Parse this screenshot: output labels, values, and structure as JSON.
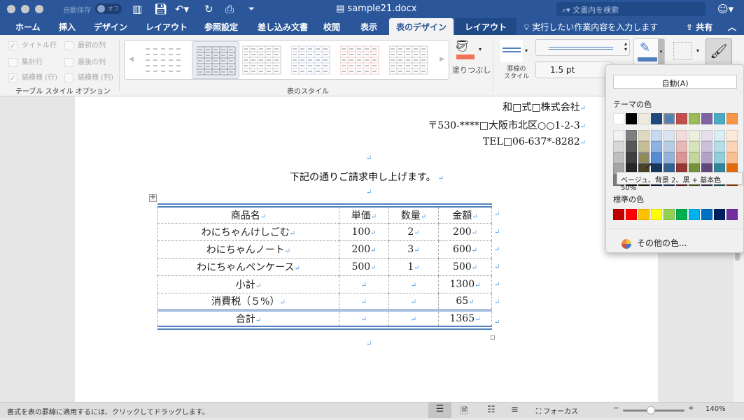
{
  "title": {
    "autosave": "自動保存",
    "autosave_state": "オフ",
    "doc": "sample21.docx",
    "search_placeholder": "文書内を検索"
  },
  "tabs": [
    "ホーム",
    "挿入",
    "デザイン",
    "レイアウト",
    "参照設定",
    "差し込み文書",
    "校閲",
    "表示",
    "表のデザイン",
    "レイアウト"
  ],
  "tell_me": "実行したい作業内容を入力します",
  "share": "共有",
  "ribbon": {
    "options": [
      {
        "label": "タイトル行",
        "checked": true
      },
      {
        "label": "最初の列",
        "checked": false
      },
      {
        "label": "集計行",
        "checked": false
      },
      {
        "label": "最後の列",
        "checked": false
      },
      {
        "label": "縞模様 (行)",
        "checked": true
      },
      {
        "label": "縞模様 (列)",
        "checked": false
      }
    ],
    "options_group": "テーブル スタイル オプション",
    "styles_group": "表のスタイル",
    "shading": "塗りつぶし",
    "border_style_l1": "罫線の",
    "border_style_l2": "スタイル",
    "pen_weight": "1.5 pt"
  },
  "document": {
    "company": "和□式□株式会社",
    "address": "〒530-****□大阪市北区○○1-2-3",
    "tel": "TEL□06-637*-8282",
    "intro": "下記の通りご請求申し上げます。",
    "table": [
      [
        "商品名",
        "単価",
        "数量",
        "金額"
      ],
      [
        "わにちゃんけしごむ",
        "100",
        "2",
        "200"
      ],
      [
        "わにちゃんノート",
        "200",
        "3",
        "600"
      ],
      [
        "わにちゃんペンケース",
        "500",
        "1",
        "500"
      ],
      [
        "小計",
        "",
        "",
        "1300"
      ],
      [
        "消費税（５%）",
        "",
        "",
        "65"
      ],
      [
        "合計",
        "",
        "",
        "1365"
      ]
    ]
  },
  "color_menu": {
    "auto": "自動(A)",
    "theme_label": "テーマの色",
    "standard_label": "標準の色",
    "tooltip": "ベージュ、背景 2、黒 + 基本色 50%",
    "more": "その他の色...",
    "theme_top": [
      "#ffffff",
      "#000000",
      "#eeece1",
      "#1f497d",
      "#4f81bd",
      "#c0504d",
      "#9bbb59",
      "#8064a2",
      "#4bacc6",
      "#f79646"
    ],
    "theme_shades": [
      [
        "#f2f2f2",
        "#d9d9d9",
        "#bfbfbf",
        "#a6a6a6",
        "#7f7f7f"
      ],
      [
        "#7f7f7f",
        "#595959",
        "#3f3f3f",
        "#262626",
        "#0d0d0d"
      ],
      [
        "#ddd9c3",
        "#c4bd97",
        "#938953",
        "#494429",
        "#1d1b10"
      ],
      [
        "#c6d9f0",
        "#8db3e2",
        "#548dd4",
        "#17365d",
        "#0f243e"
      ],
      [
        "#dbe5f1",
        "#b8cce4",
        "#95b3d7",
        "#366092",
        "#244061"
      ],
      [
        "#f2dcdb",
        "#e5b9b7",
        "#d99694",
        "#953734",
        "#632423"
      ],
      [
        "#ebf1dd",
        "#d7e3bc",
        "#c3d69b",
        "#76923c",
        "#4f6128"
      ],
      [
        "#e5e0ec",
        "#ccc1d9",
        "#b2a2c7",
        "#5f497a",
        "#3f3151"
      ],
      [
        "#dbeef3",
        "#b7dde8",
        "#92cddc",
        "#31859b",
        "#205867"
      ],
      [
        "#fdeada",
        "#fbd5b5",
        "#fac08f",
        "#e36c09",
        "#974806"
      ]
    ],
    "standard": [
      "#c00000",
      "#ff0000",
      "#ffc000",
      "#ffff00",
      "#92d050",
      "#00b050",
      "#00b0f0",
      "#0070c0",
      "#002060",
      "#7030a0"
    ]
  },
  "status": {
    "message": "書式を表の罫線に適用するには、クリックしてドラッグします。",
    "focus": "フォーカス",
    "zoom": "140%"
  }
}
